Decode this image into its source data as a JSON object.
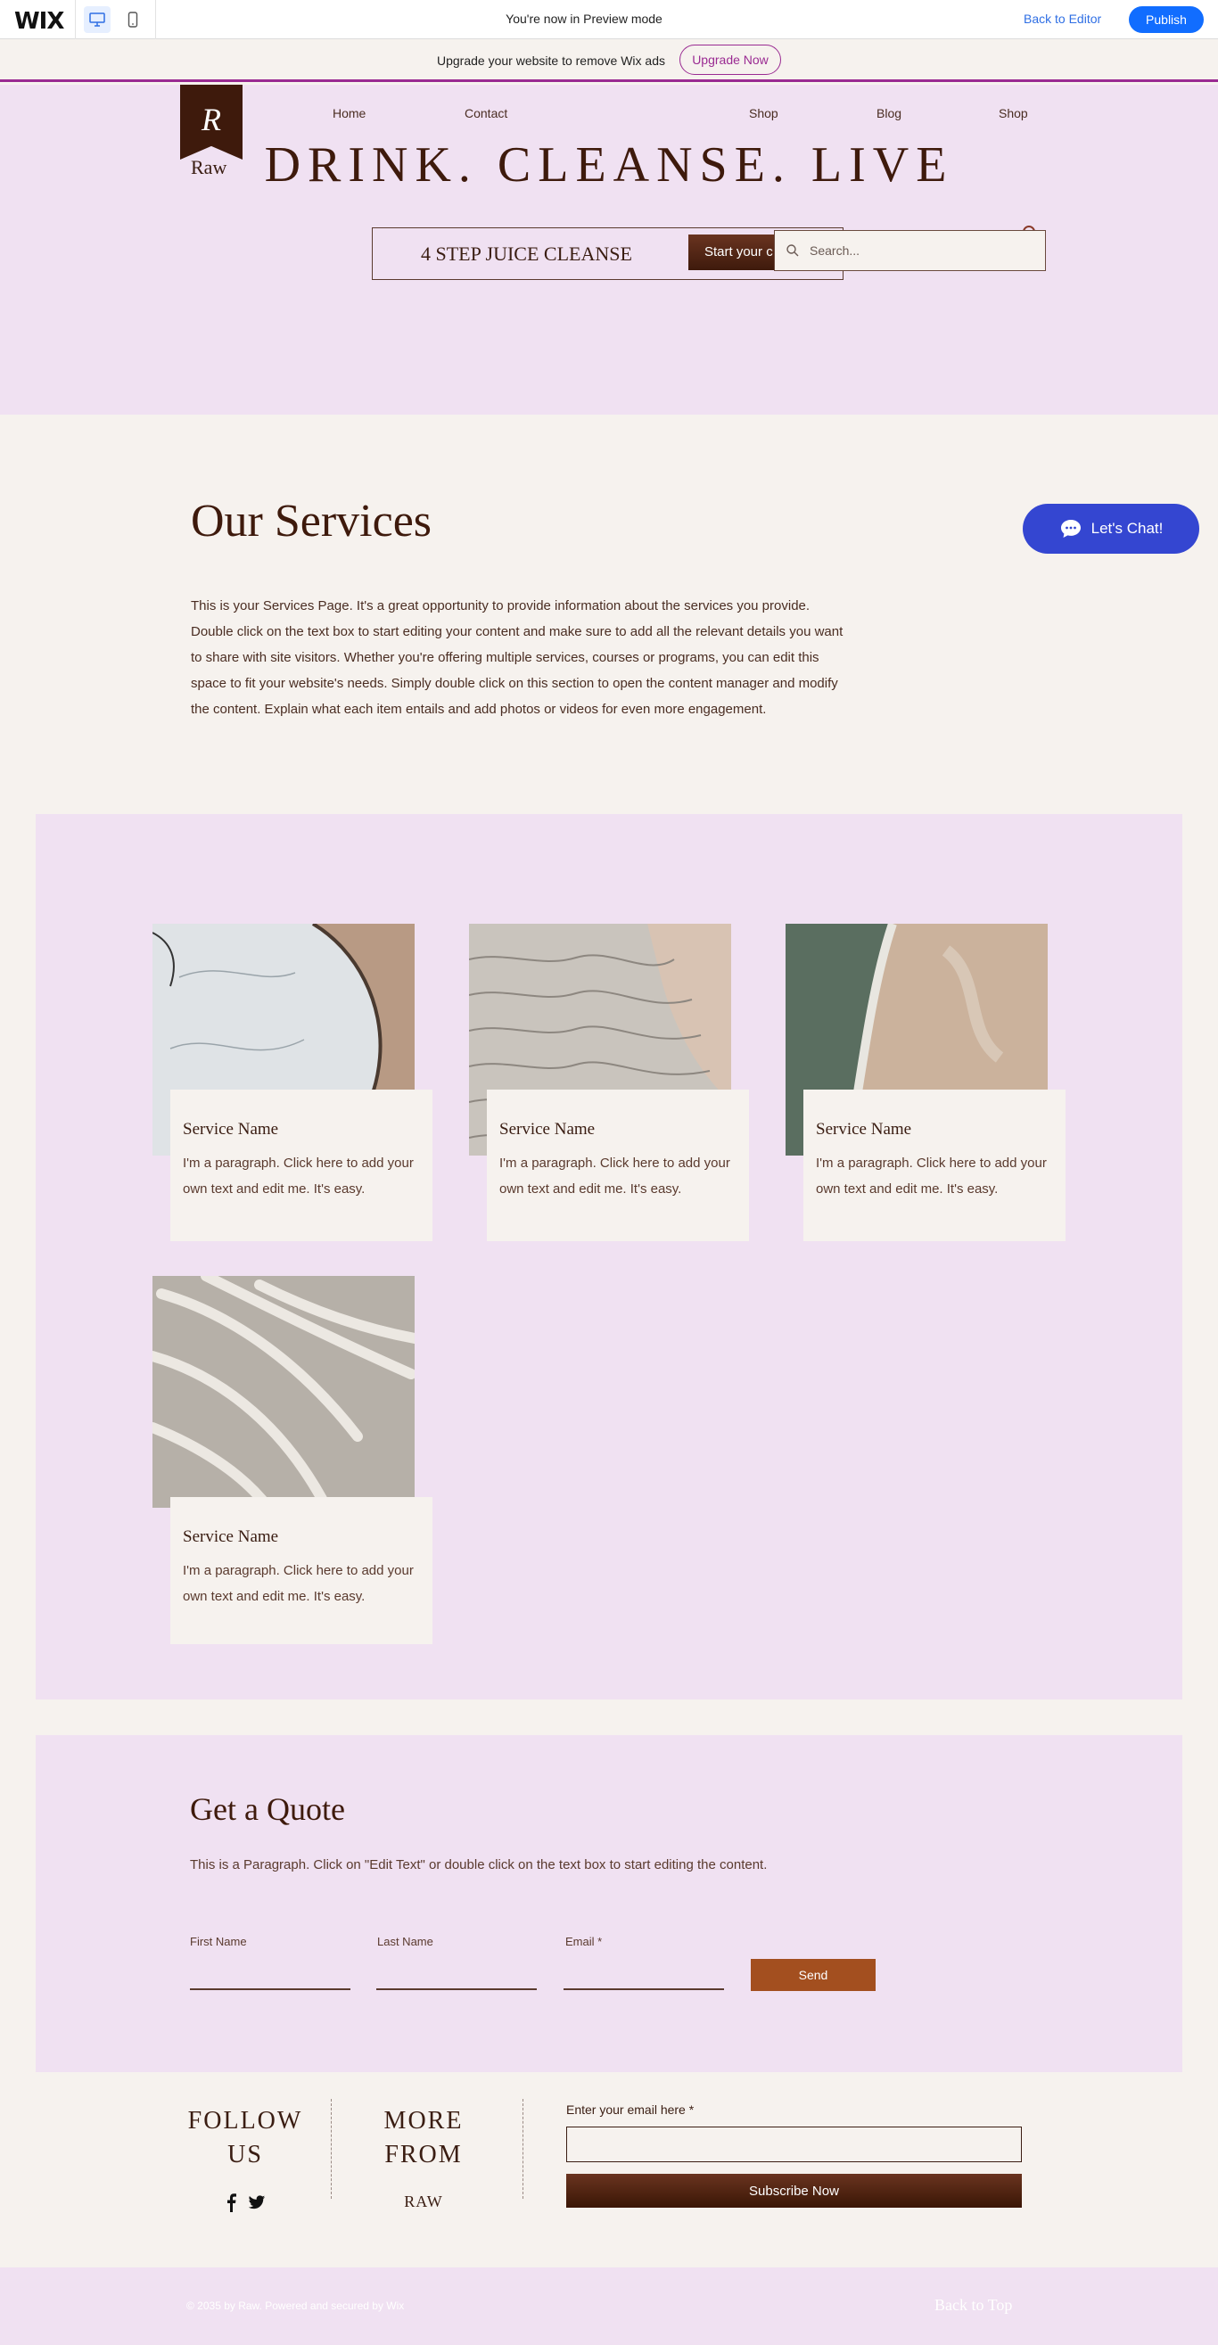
{
  "wix_bar": {
    "logo": "WIX",
    "preview_text": "You're now in Preview mode",
    "back_label": "Back to Editor",
    "publish_label": "Publish"
  },
  "upgrade_bar": {
    "message": "Upgrade your website to remove Wix ads",
    "button_label": "Upgrade Now"
  },
  "header": {
    "brand_mark": "R",
    "brand_name": "Raw",
    "nav": [
      "Home",
      "Contact",
      "Shop",
      "Blog",
      "Shop"
    ],
    "headline": "DRINK. CLEANSE. LIVE",
    "cleanse_text": "4 STEP JUICE CLEANSE",
    "cleanse_button": "Start your c",
    "search_placeholder": "Search..."
  },
  "services": {
    "title": "Our Services",
    "body": "This is your Services Page. It's a great opportunity to provide information about the services you provide. Double click on the text box to start editing your content and make sure to add all the relevant details you want to share with site visitors. Whether you're offering multiple services, courses or programs, you can edit this space to fit your website's needs. Simply double click on this section to open the content manager and modify the content. Explain what each item entails and add photos or videos for even more engagement.",
    "items": [
      {
        "name": "Service Name",
        "text": "I'm a paragraph. Click here to add your own text and edit me. It's easy."
      },
      {
        "name": "Service Name",
        "text": "I'm a paragraph. Click here to add your own text and edit me. It's easy."
      },
      {
        "name": "Service Name",
        "text": "I'm a paragraph. Click here to add your own text and edit me. It's easy."
      },
      {
        "name": "Service Name",
        "text": "I'm a paragraph. Click here to add your own text and edit me. It's easy."
      }
    ]
  },
  "chat": {
    "label": "Let's Chat!"
  },
  "quote": {
    "title": "Get a Quote",
    "body": "This is a Paragraph. Click on \"Edit Text\" or double click on the text box to start editing the content.",
    "first_name_label": "First Name",
    "last_name_label": "Last Name",
    "email_label": "Email *",
    "send_label": "Send"
  },
  "footer": {
    "follow": "FOLLOW US",
    "more": "MORE FROM",
    "raw": "RAW",
    "email_label": "Enter your email here *",
    "subscribe_label": "Subscribe Now",
    "copyright": "© 2035 by Raw. Powered and secured by Wix",
    "back_to_top": "Back to Top"
  },
  "colors": {
    "accent": "#3e1a0c",
    "lavender": "#f0e1f2",
    "cream": "#f6f2ee",
    "wix_blue": "#116dff",
    "upgrade_purple": "#9a2b92",
    "chat_blue": "#3446d1",
    "send_orange": "#a34f1f"
  },
  "icons": [
    "desktop-icon",
    "mobile-icon",
    "search-icon",
    "cart-icon",
    "chat-icon",
    "facebook-icon",
    "twitter-icon"
  ]
}
